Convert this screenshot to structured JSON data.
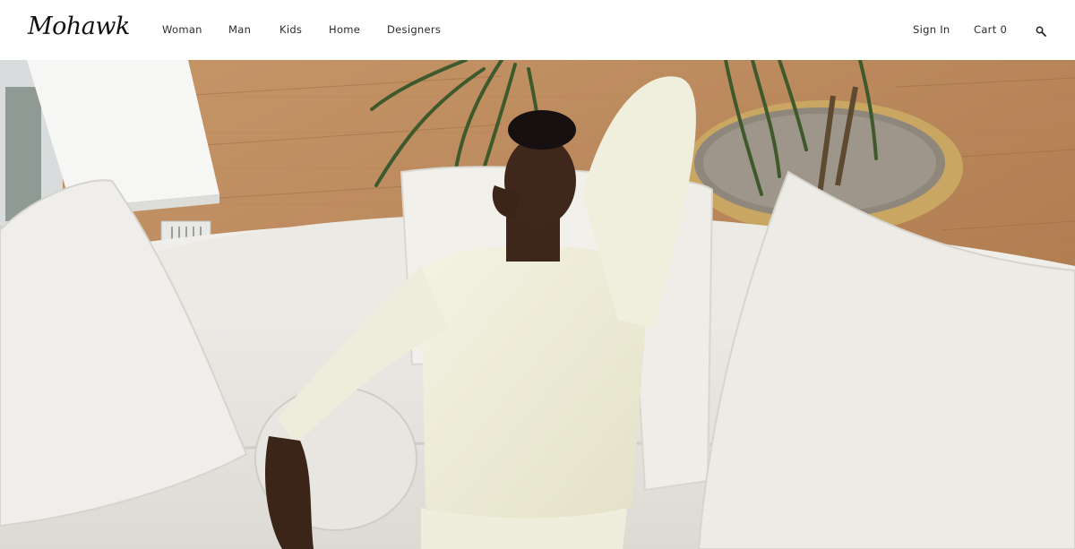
{
  "brand": {
    "logo_text": "Mohawk"
  },
  "nav": {
    "primary": [
      {
        "label": "Woman"
      },
      {
        "label": "Man"
      },
      {
        "label": "Kids"
      },
      {
        "label": "Home"
      },
      {
        "label": "Designers"
      }
    ],
    "sign_in_label": "Sign In",
    "cart_label": "Cart 0",
    "search_icon": "search-icon"
  },
  "hero": {
    "image_subject": "Model in cream sweatshirt reclining on white sofa with pillows and potted palm",
    "colors": {
      "floor": "#b9875a",
      "sofa": "#ecebe6",
      "sweatshirt": "#efeed9",
      "plant": "#3e5a2c"
    }
  }
}
